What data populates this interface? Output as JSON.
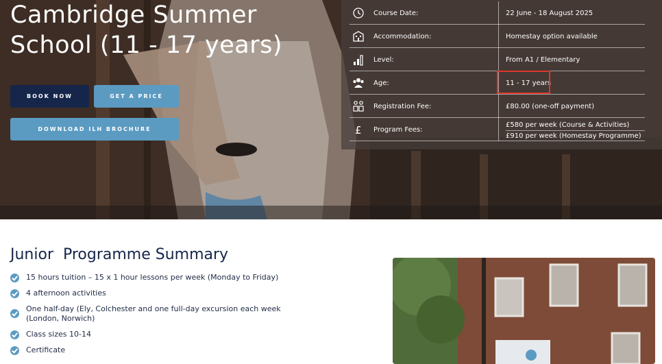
{
  "hero": {
    "title_line1": "Cambridge Summer",
    "title_line2": "School (11 - 17 years)",
    "buttons": {
      "book_now": "BOOK NOW",
      "get_price": "GET A PRICE",
      "download_brochure": "DOWNLOAD ILH BROCHURE"
    }
  },
  "course_info": [
    {
      "icon": "calendar-clock-icon",
      "label": "Course Date:",
      "value": "22 June - 18 August 2025"
    },
    {
      "icon": "building-icon",
      "label": "Accommodation:",
      "value": "Homestay option available"
    },
    {
      "icon": "level-bars-icon",
      "label": "Level:",
      "value": "From A1 / Elementary"
    },
    {
      "icon": "group-people-icon",
      "label": "Age:",
      "value": "11 - 17 years"
    },
    {
      "icon": "registration-people-icon",
      "label": "Registration Fee:",
      "value": "£80.00 (one-off payment)"
    }
  ],
  "program_fees": {
    "icon": "pound-icon",
    "label": "Program Fees:",
    "values": [
      "£580 per week (Course & Activities)",
      "£910 per week (Homestay Programme)"
    ]
  },
  "summary": {
    "title": "Junior  Programme Summary",
    "items": [
      "15 hours tuition – 15 x 1 hour lessons per week (Monday to Friday)",
      "4 afternoon activities",
      "One half-day (Ely, Colchester and one full-day excursion each week (London, Norwich)",
      "Class sizes 10-14",
      "Certificate"
    ]
  },
  "colors": {
    "navy": "#15264a",
    "accent_blue": "#5b9bc2",
    "highlight_red": "#e0362b"
  }
}
